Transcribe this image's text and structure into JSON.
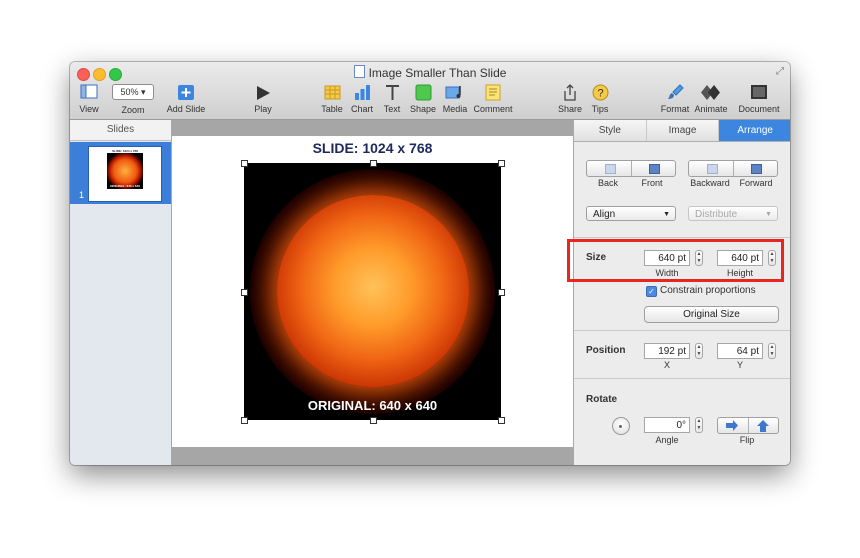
{
  "window": {
    "title": "Image Smaller Than Slide"
  },
  "toolbar": {
    "view_label": "View",
    "zoom_value": "50%",
    "zoom_label": "Zoom",
    "add_slide_label": "Add Slide",
    "play_label": "Play",
    "table_label": "Table",
    "chart_label": "Chart",
    "text_label": "Text",
    "shape_label": "Shape",
    "media_label": "Media",
    "comment_label": "Comment",
    "share_label": "Share",
    "tips_label": "Tips",
    "format_label": "Format",
    "animate_label": "Animate",
    "document_label": "Document"
  },
  "sidebar": {
    "header": "Slides",
    "slides": [
      {
        "number": "1"
      }
    ]
  },
  "slide": {
    "title": "SLIDE: 1024 x 768",
    "image_caption": "ORIGINAL: 640 x 640"
  },
  "inspector": {
    "tabs": [
      "Style",
      "Image",
      "Arrange"
    ],
    "active_tab": "Arrange",
    "back_label": "Back",
    "front_label": "Front",
    "backward_label": "Backward",
    "forward_label": "Forward",
    "align_label": "Align",
    "distribute_label": "Distribute",
    "size_title": "Size",
    "width_value": "640 pt",
    "width_label": "Width",
    "height_value": "640 pt",
    "height_label": "Height",
    "constrain_label": "Constrain proportions",
    "constrain_checked": true,
    "original_size_label": "Original Size",
    "position_title": "Position",
    "x_value": "192 pt",
    "x_label": "X",
    "y_value": "64 pt",
    "y_label": "Y",
    "rotate_title": "Rotate",
    "angle_value": "0°",
    "angle_label": "Angle",
    "flip_label": "Flip"
  },
  "colors": {
    "accent": "#3d86e0",
    "highlight": "#e8261f"
  }
}
